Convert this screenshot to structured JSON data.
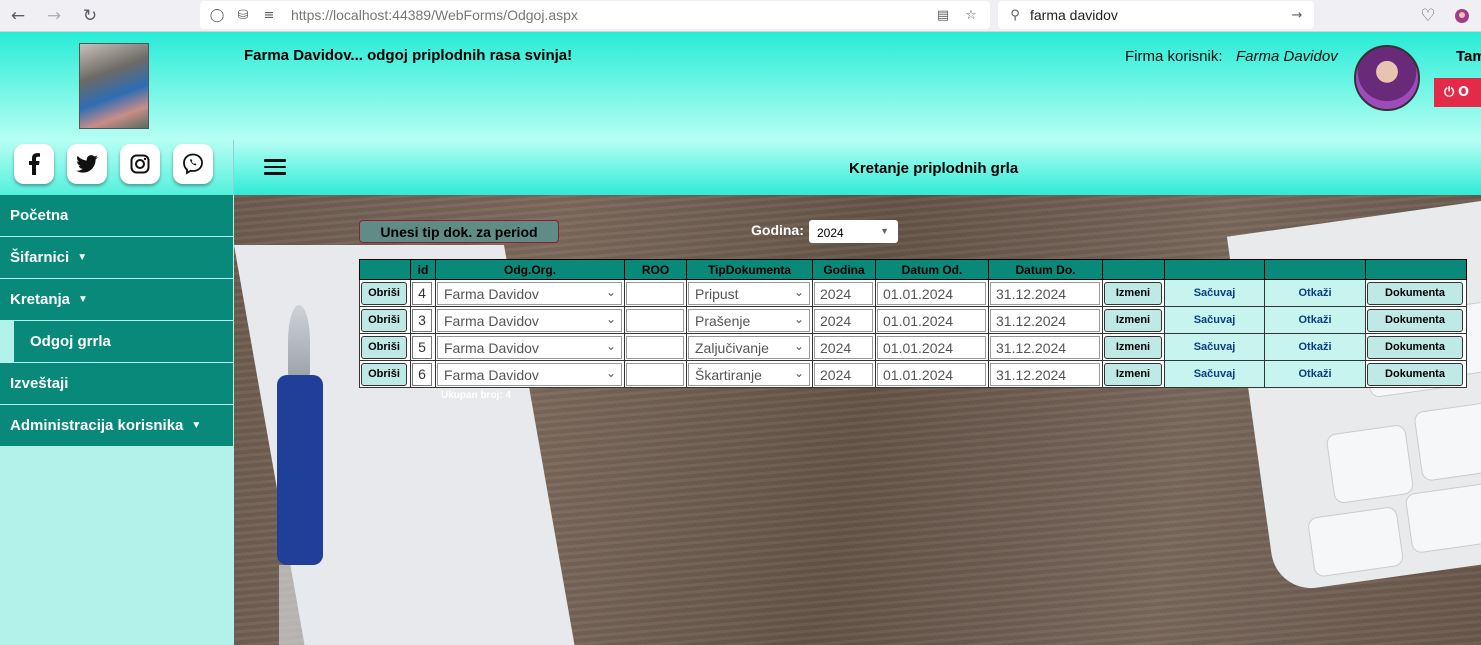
{
  "browser": {
    "url": "https://localhost:44389/WebForms/Odgoj.aspx",
    "search": "farma davidov"
  },
  "header": {
    "brand_title": "Farma Davidov... odgoj priplodnih rasa svinja!",
    "firm_label": "Firma korisnik:",
    "firm_name": "Farma Davidov",
    "user_name": "Tam",
    "logout_label": "O"
  },
  "social": [
    "facebook-icon",
    "twitter-icon",
    "instagram-icon",
    "viber-icon"
  ],
  "sidebar": {
    "items": [
      {
        "label": "Početna"
      },
      {
        "label": "Šifarnici"
      },
      {
        "label": "Kretanja"
      },
      {
        "label": "Odgoj grrla"
      },
      {
        "label": "Izveštaji"
      },
      {
        "label": "Administracija korisnika"
      }
    ],
    "caret": "▼"
  },
  "title_bar": {
    "title": "Kretanje priplodnih grla"
  },
  "main": {
    "enter_button": "Unesi tip dok. za period",
    "year_label": "Godina:",
    "year_value": "2024",
    "columns": [
      "",
      "id",
      "Odg.Org.",
      "ROO",
      "TipDokumenta",
      "Godina",
      "Datum Od.",
      "Datum Do.",
      "",
      "",
      "",
      ""
    ],
    "rows": [
      {
        "delete": "Obriši",
        "id": "4",
        "org": "Farma Davidov",
        "roo": "",
        "tip": "Pripust",
        "godina": "2024",
        "od": "01.01.2024",
        "do": "31.12.2024",
        "edit": "Izmeni",
        "save": "Sačuvaj",
        "cancel": "Otkaži",
        "docs": "Dokumenta"
      },
      {
        "delete": "Obriši",
        "id": "3",
        "org": "Farma Davidov",
        "roo": "",
        "tip": "Prašenje",
        "godina": "2024",
        "od": "01.01.2024",
        "do": "31.12.2024",
        "edit": "Izmeni",
        "save": "Sačuvaj",
        "cancel": "Otkaži",
        "docs": "Dokumenta"
      },
      {
        "delete": "Obriši",
        "id": "5",
        "org": "Farma Davidov",
        "roo": "",
        "tip": "Zaljučivanje",
        "godina": "2024",
        "od": "01.01.2024",
        "do": "31.12.2024",
        "edit": "Izmeni",
        "save": "Sačuvaj",
        "cancel": "Otkaži",
        "docs": "Dokumenta"
      },
      {
        "delete": "Obriši",
        "id": "6",
        "org": "Farma Davidov",
        "roo": "",
        "tip": "Škartiranje",
        "godina": "2024",
        "od": "01.01.2024",
        "do": "31.12.2024",
        "edit": "Izmeni",
        "save": "Sačuvaj",
        "cancel": "Otkaži",
        "docs": "Dokumenta"
      }
    ],
    "total": "Ukupan broj: 4"
  }
}
